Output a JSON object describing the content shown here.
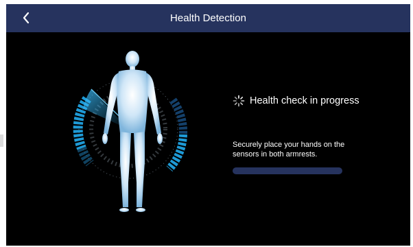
{
  "header": {
    "title": "Health Detection",
    "back_icon": "chevron-left-icon",
    "background": "#26335e"
  },
  "status": {
    "icon": "loading-spinner-icon",
    "text": "Health check in progress"
  },
  "instruction": {
    "text": "Securely place your hands on the sensors in both armrests."
  },
  "progress": {
    "value": 0,
    "track_color": "#26335e"
  },
  "colors": {
    "background": "#000000",
    "accent": "#1e9ad6",
    "text": "#ffffff"
  }
}
